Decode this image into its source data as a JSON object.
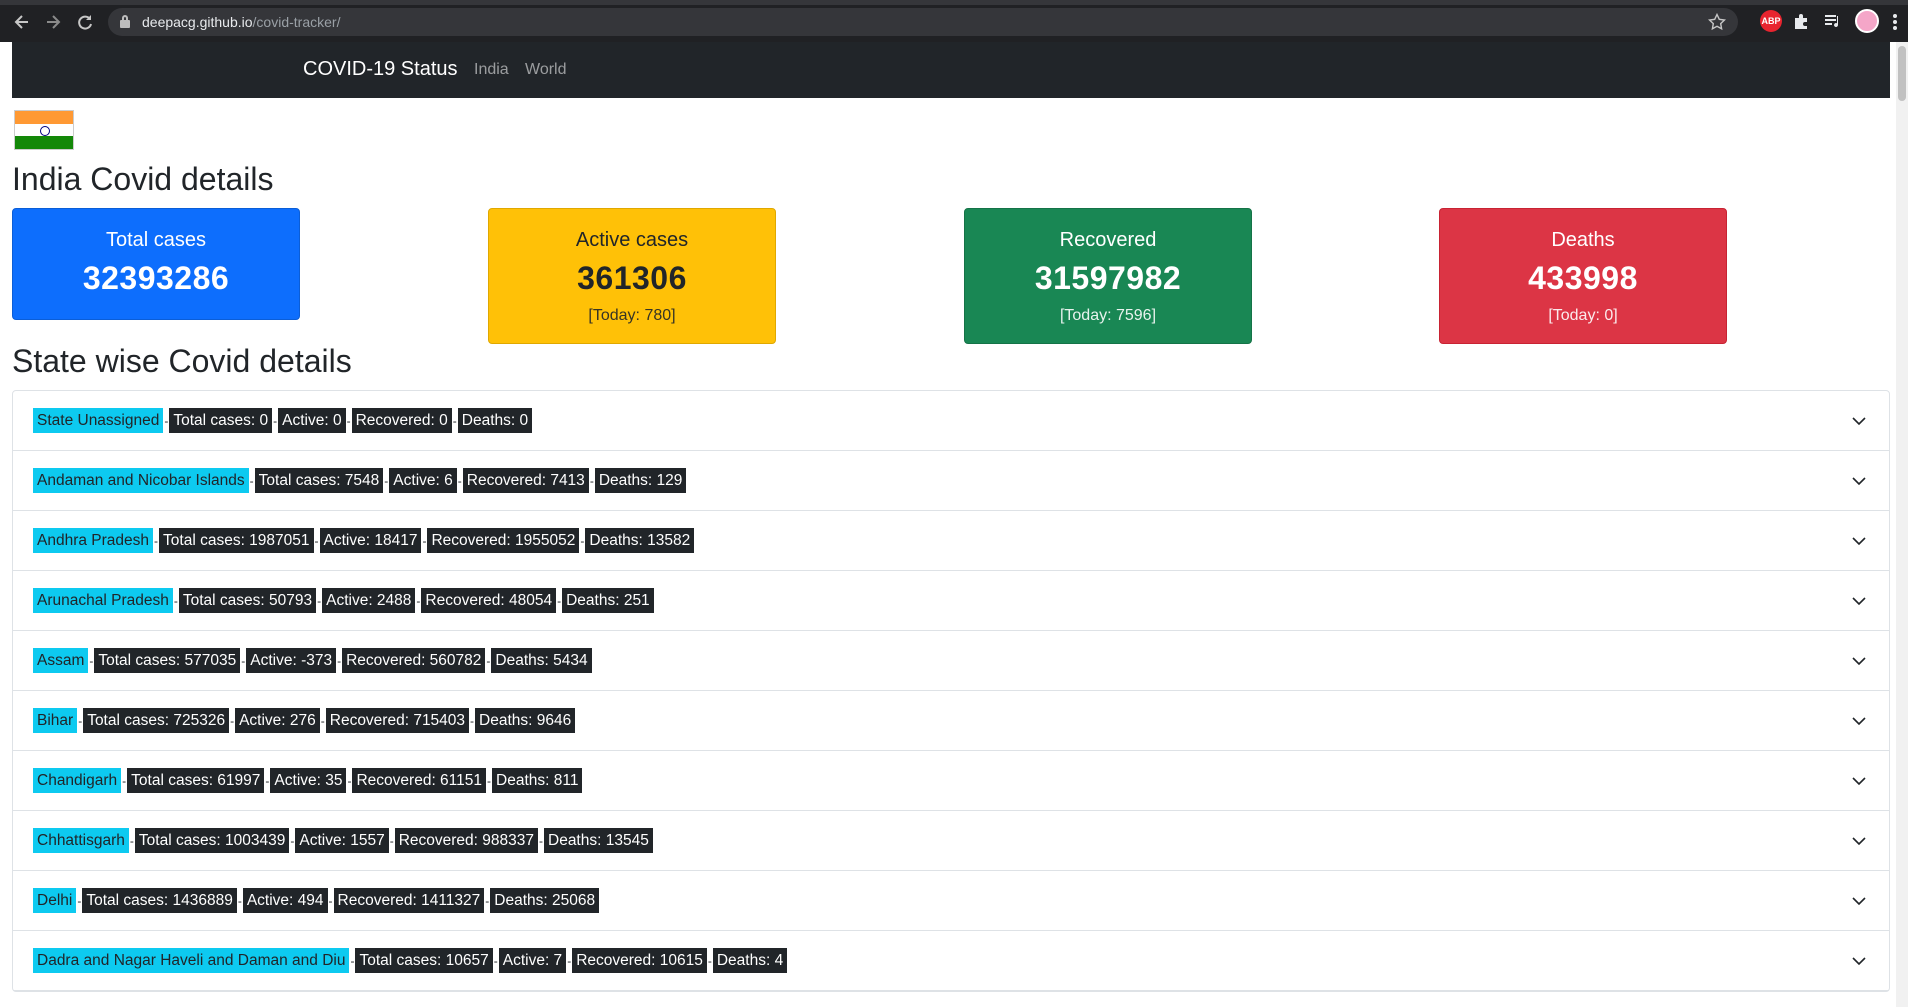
{
  "browser": {
    "url_host": "deepacg.github.io",
    "url_path": "/covid-tracker/",
    "ext_abp": "ABP"
  },
  "navbar": {
    "brand": "COVID-19 Status",
    "links": [
      "India",
      "World"
    ]
  },
  "india": {
    "heading": "India Covid details",
    "total": {
      "label": "Total cases",
      "value": "32393286"
    },
    "active": {
      "label": "Active cases",
      "value": "361306",
      "today": "[Today: 780]"
    },
    "recovered": {
      "label": "Recovered",
      "value": "31597982",
      "today": "[Today: 7596]"
    },
    "deaths": {
      "label": "Deaths",
      "value": "433998",
      "today": "[Today: 0]"
    }
  },
  "states_heading": "State wise Covid details",
  "colors": {
    "total": "#0d6efd",
    "active": "#ffc107",
    "recovered": "#198754",
    "deaths": "#dc3545",
    "state_badge": "#0dcaf0",
    "stat_badge": "#212529"
  },
  "states": [
    {
      "name": "State Unassigned",
      "total": "Total cases: 0",
      "active": "Active: 0",
      "recovered": "Recovered: 0",
      "deaths": "Deaths: 0"
    },
    {
      "name": "Andaman and Nicobar Islands",
      "total": "Total cases: 7548",
      "active": "Active: 6",
      "recovered": "Recovered: 7413",
      "deaths": "Deaths: 129"
    },
    {
      "name": "Andhra Pradesh",
      "total": "Total cases: 1987051",
      "active": "Active: 18417",
      "recovered": "Recovered: 1955052",
      "deaths": "Deaths: 13582"
    },
    {
      "name": "Arunachal Pradesh",
      "total": "Total cases: 50793",
      "active": "Active: 2488",
      "recovered": "Recovered: 48054",
      "deaths": "Deaths: 251"
    },
    {
      "name": "Assam",
      "total": "Total cases: 577035",
      "active": "Active: -373",
      "recovered": "Recovered: 560782",
      "deaths": "Deaths: 5434"
    },
    {
      "name": "Bihar",
      "total": "Total cases: 725326",
      "active": "Active: 276",
      "recovered": "Recovered: 715403",
      "deaths": "Deaths: 9646"
    },
    {
      "name": "Chandigarh",
      "total": "Total cases: 61997",
      "active": "Active: 35",
      "recovered": "Recovered: 61151",
      "deaths": "Deaths: 811"
    },
    {
      "name": "Chhattisgarh",
      "total": "Total cases: 1003439",
      "active": "Active: 1557",
      "recovered": "Recovered: 988337",
      "deaths": "Deaths: 13545"
    },
    {
      "name": "Delhi",
      "total": "Total cases: 1436889",
      "active": "Active: 494",
      "recovered": "Recovered: 1411327",
      "deaths": "Deaths: 25068"
    },
    {
      "name": "Dadra and Nagar Haveli and Daman and Diu",
      "total": "Total cases: 10657",
      "active": "Active: 7",
      "recovered": "Recovered: 10615",
      "deaths": "Deaths: 4"
    }
  ],
  "separator": "-"
}
